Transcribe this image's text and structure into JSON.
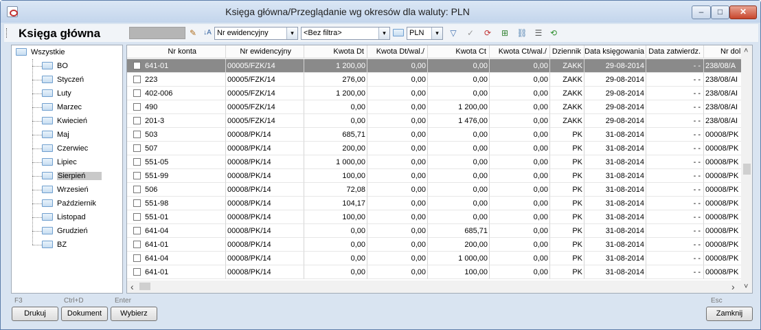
{
  "window": {
    "title": "Księga główna/Przeglądanie wg okresów dla waluty: PLN",
    "min_glyph": "–",
    "max_glyph": "□",
    "close_glyph": "✕"
  },
  "toolbar": {
    "heading": "Księga główna",
    "sort_field": "Nr ewidencyjny",
    "filter": "<Bez filtra>",
    "currency": "PLN",
    "dropdown_glyph": "▾"
  },
  "tree": {
    "root": "Wszystkie",
    "items": [
      "BO",
      "Styczeń",
      "Luty",
      "Marzec",
      "Kwiecień",
      "Maj",
      "Czerwiec",
      "Lipiec",
      "Sierpień",
      "Wrzesień",
      "Październik",
      "Listopad",
      "Grudzień",
      "BZ"
    ],
    "selected": "Sierpień"
  },
  "grid": {
    "columns": [
      "Nr konta",
      "Nr ewidencyjny",
      "Kwota Dt",
      "Kwota Dt/wal./",
      "Kwota Ct",
      "Kwota Ct/wal./",
      "Dziennik",
      "Data księgowania",
      "Data zatwierdz.",
      "Nr dol"
    ],
    "rows": [
      [
        "641-01",
        "00005/FZK/14",
        "1 200,00",
        "0,00",
        "0,00",
        "0,00",
        "ZAKK",
        "29-08-2014",
        "- -",
        "238/08/A"
      ],
      [
        "223",
        "00005/FZK/14",
        "276,00",
        "0,00",
        "0,00",
        "0,00",
        "ZAKK",
        "29-08-2014",
        "- -",
        "238/08/AI"
      ],
      [
        "402-006",
        "00005/FZK/14",
        "1 200,00",
        "0,00",
        "0,00",
        "0,00",
        "ZAKK",
        "29-08-2014",
        "- -",
        "238/08/AI"
      ],
      [
        "490",
        "00005/FZK/14",
        "0,00",
        "0,00",
        "1 200,00",
        "0,00",
        "ZAKK",
        "29-08-2014",
        "- -",
        "238/08/AI"
      ],
      [
        "201-3",
        "00005/FZK/14",
        "0,00",
        "0,00",
        "1 476,00",
        "0,00",
        "ZAKK",
        "29-08-2014",
        "- -",
        "238/08/AI"
      ],
      [
        "503",
        "00008/PK/14",
        "685,71",
        "0,00",
        "0,00",
        "0,00",
        "PK",
        "31-08-2014",
        "- -",
        "00008/PK"
      ],
      [
        "507",
        "00008/PK/14",
        "200,00",
        "0,00",
        "0,00",
        "0,00",
        "PK",
        "31-08-2014",
        "- -",
        "00008/PK"
      ],
      [
        "551-05",
        "00008/PK/14",
        "1 000,00",
        "0,00",
        "0,00",
        "0,00",
        "PK",
        "31-08-2014",
        "- -",
        "00008/PK"
      ],
      [
        "551-99",
        "00008/PK/14",
        "100,00",
        "0,00",
        "0,00",
        "0,00",
        "PK",
        "31-08-2014",
        "- -",
        "00008/PK"
      ],
      [
        "506",
        "00008/PK/14",
        "72,08",
        "0,00",
        "0,00",
        "0,00",
        "PK",
        "31-08-2014",
        "- -",
        "00008/PK"
      ],
      [
        "551-98",
        "00008/PK/14",
        "104,17",
        "0,00",
        "0,00",
        "0,00",
        "PK",
        "31-08-2014",
        "- -",
        "00008/PK"
      ],
      [
        "551-01",
        "00008/PK/14",
        "100,00",
        "0,00",
        "0,00",
        "0,00",
        "PK",
        "31-08-2014",
        "- -",
        "00008/PK"
      ],
      [
        "641-04",
        "00008/PK/14",
        "0,00",
        "0,00",
        "685,71",
        "0,00",
        "PK",
        "31-08-2014",
        "- -",
        "00008/PK"
      ],
      [
        "641-01",
        "00008/PK/14",
        "0,00",
        "0,00",
        "200,00",
        "0,00",
        "PK",
        "31-08-2014",
        "- -",
        "00008/PK"
      ],
      [
        "641-04",
        "00008/PK/14",
        "0,00",
        "0,00",
        "1 000,00",
        "0,00",
        "PK",
        "31-08-2014",
        "- -",
        "00008/PK"
      ],
      [
        "641-01",
        "00008/PK/14",
        "0,00",
        "0,00",
        "100,00",
        "0,00",
        "PK",
        "31-08-2014",
        "- -",
        "00008/PK"
      ]
    ],
    "selected_row": 0
  },
  "footer": {
    "hints": {
      "print": "F3",
      "document": "Ctrl+D",
      "select": "Enter",
      "close": "Esc"
    },
    "buttons": {
      "print": "Drukuj",
      "document": "Dokument",
      "select": "Wybierz",
      "close": "Zamknij"
    }
  },
  "scroll": {
    "left": "‹",
    "right": "›",
    "up": "˄",
    "down": "˅"
  }
}
